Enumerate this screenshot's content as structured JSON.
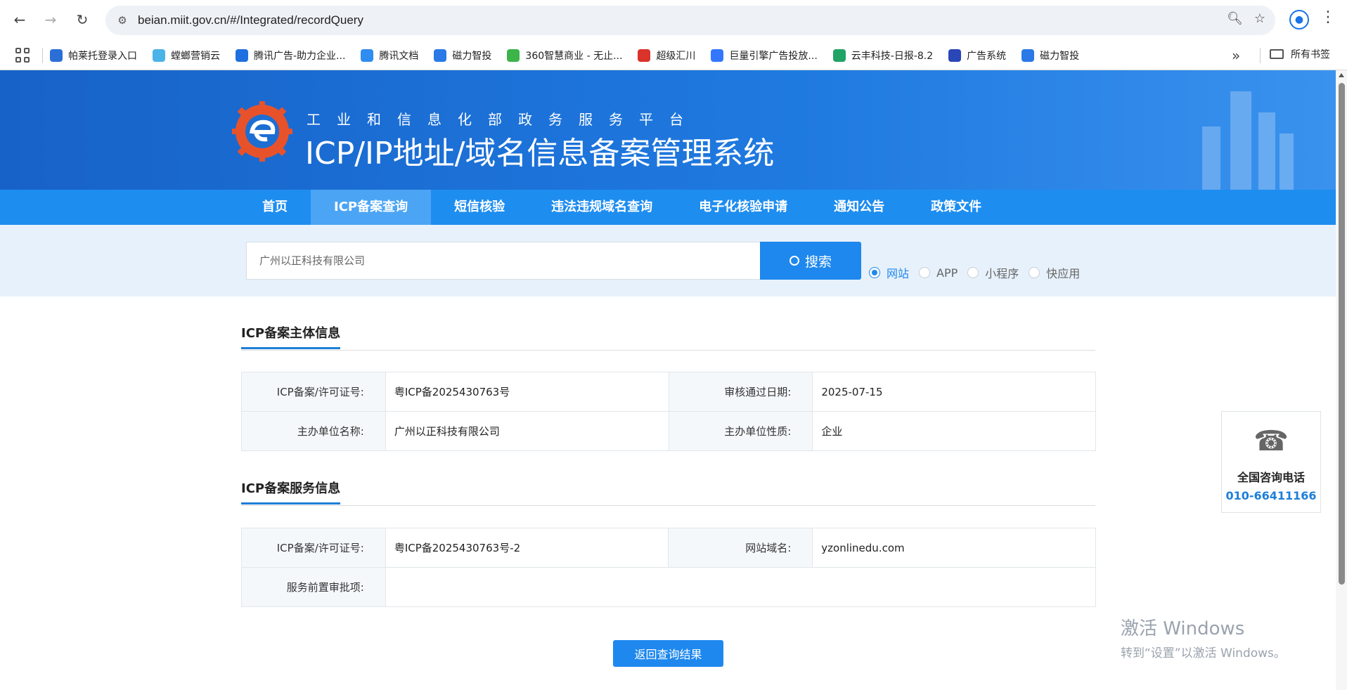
{
  "browser": {
    "url": "beian.miit.gov.cn/#/Integrated/recordQuery",
    "bookmarks": [
      {
        "label": "帕莱托登录入口",
        "color": "#2b6fd6"
      },
      {
        "label": "螳螂营销云",
        "color": "#4bb3e8"
      },
      {
        "label": "腾讯广告-助力企业...",
        "color": "#1f6fe0"
      },
      {
        "label": "腾讯文档",
        "color": "#2f8cf0"
      },
      {
        "label": "磁力智投",
        "color": "#2a79e6"
      },
      {
        "label": "360智慧商业 - 无止...",
        "color": "#3cb44a"
      },
      {
        "label": "超级汇川",
        "color": "#d9332b"
      },
      {
        "label": "巨量引擎广告投放...",
        "color": "#3377ff"
      },
      {
        "label": "云丰科技-日报-8.2",
        "color": "#21a366"
      },
      {
        "label": "广告系统",
        "color": "#2a47b8"
      },
      {
        "label": "磁力智投",
        "color": "#2a79e6"
      }
    ],
    "all_bookmarks": "所有书签"
  },
  "site": {
    "subtitle": "工业和信息化部政务服务平台",
    "title": "ICP/IP地址/域名信息备案管理系统",
    "menu": [
      "首页",
      "ICP备案查询",
      "短信核验",
      "违法违规域名查询",
      "电子化核验申请",
      "通知公告",
      "政策文件"
    ],
    "active_menu": 1
  },
  "search": {
    "value": "广州以正科技有限公司",
    "button": "搜索",
    "types": [
      "网站",
      "APP",
      "小程序",
      "快应用"
    ],
    "selected_type": 0
  },
  "subject": {
    "title": "ICP备案主体信息",
    "license_label": "ICP备案/许可证号:",
    "license_value": "粤ICP备2025430763号",
    "date_label": "审核通过日期:",
    "date_value": "2025-07-15",
    "org_label": "主办单位名称:",
    "org_value": "广州以正科技有限公司",
    "nature_label": "主办单位性质:",
    "nature_value": "企业"
  },
  "service": {
    "title": "ICP备案服务信息",
    "license_label": "ICP备案/许可证号:",
    "license_value": "粤ICP备2025430763号-2",
    "domain_label": "网站域名:",
    "domain_value": "yzonlinedu.com",
    "prereq_label": "服务前置审批项:",
    "prereq_value": ""
  },
  "back_button": "返回查询结果",
  "hotline": {
    "label": "全国咨询电话",
    "number": "010-66411166"
  },
  "windows_notice": {
    "line1": "激活 Windows",
    "line2": "转到“设置”以激活 Windows。"
  }
}
